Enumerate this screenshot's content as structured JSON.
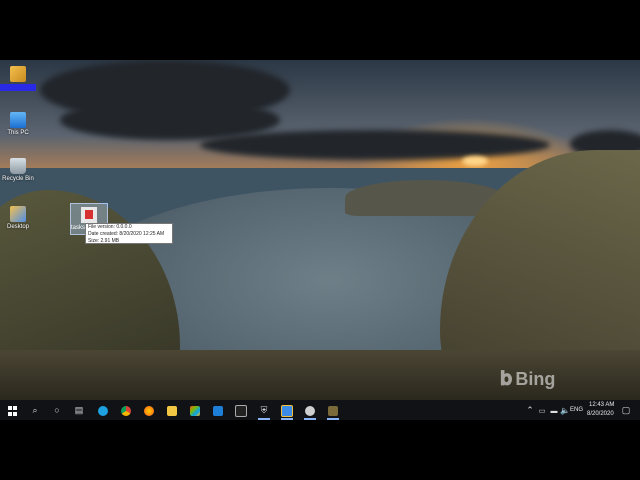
{
  "desktop": {
    "icons": [
      {
        "label": ""
      },
      {
        "label": "This PC"
      },
      {
        "label": "Recycle Bin"
      },
      {
        "label": "Desktop"
      }
    ],
    "selected_icon": {
      "label": "tasks"
    },
    "tooltip": {
      "line1": "File version: 0.0.0.0",
      "line2": "Date created: 8/20/2020 12:25 AM",
      "line3": "Size: 2.91 MB"
    },
    "watermark": "Bing"
  },
  "taskbar": {
    "pinned": [
      "start-icon",
      "search-icon",
      "cortana-icon",
      "task-view-icon",
      "edge-icon",
      "chrome-icon",
      "firefox-icon",
      "file-explorer-icon",
      "store-icon",
      "mail-icon",
      "terminal-icon",
      "security-icon",
      "app-icon",
      "app-icon-2",
      "app-icon-3"
    ],
    "tray": {
      "language": "ENG",
      "time": "12:43 AM",
      "date": "8/20/2020"
    }
  }
}
